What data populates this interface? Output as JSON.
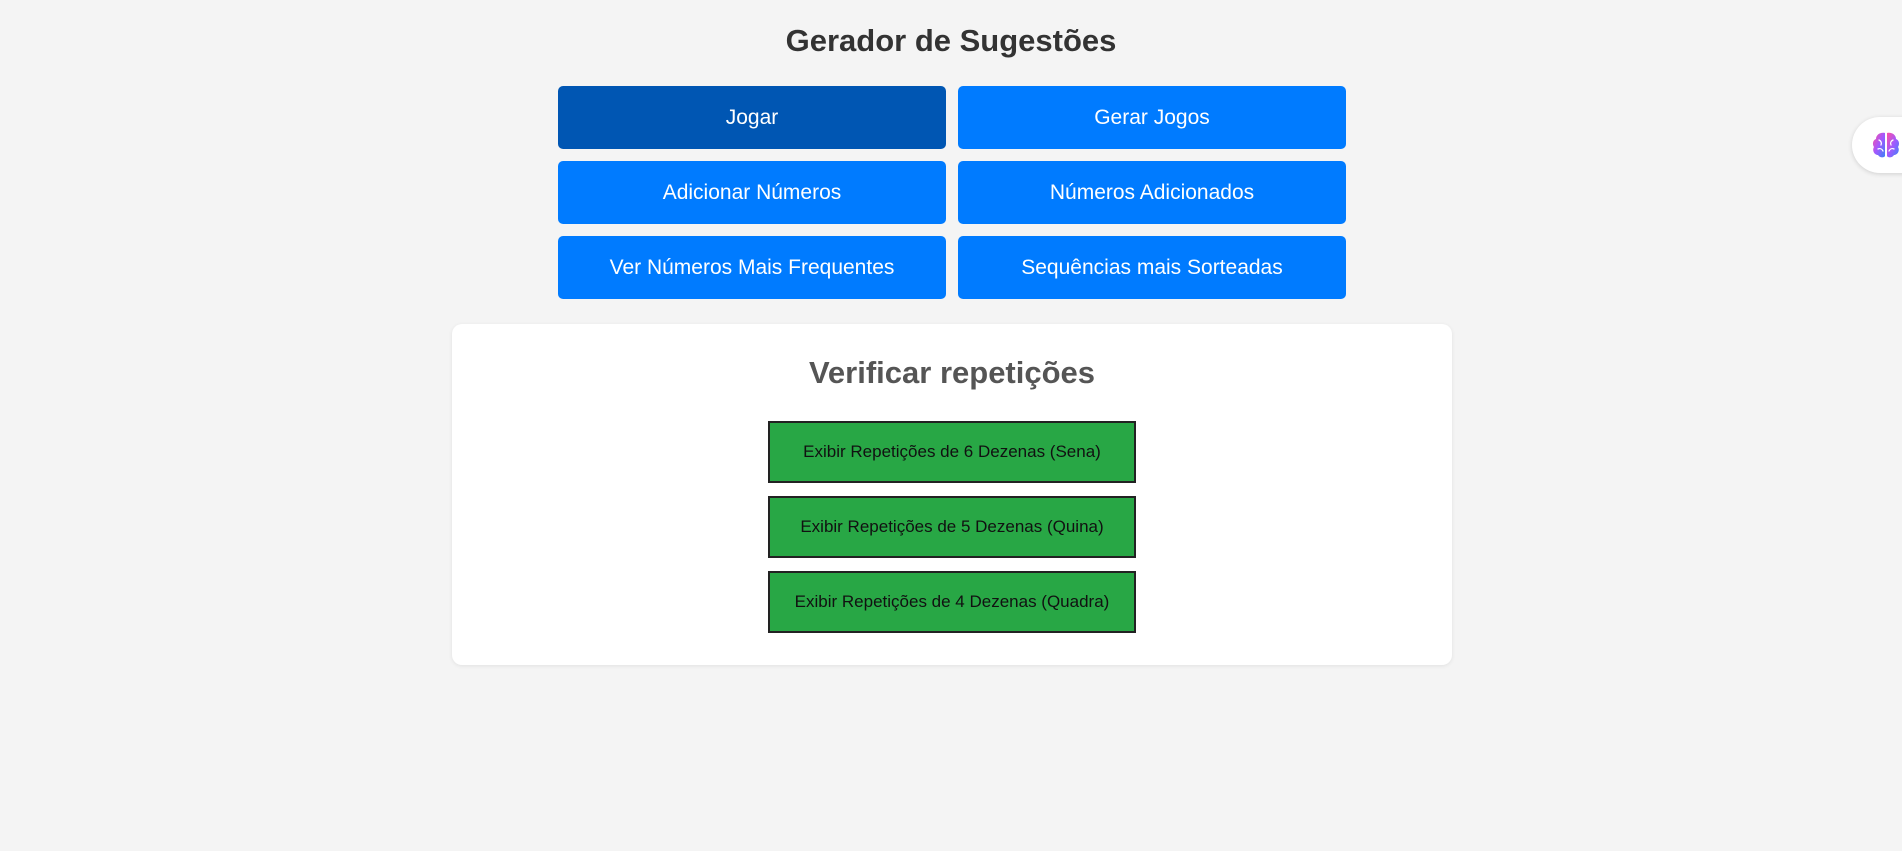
{
  "header": {
    "title": "Gerador de Sugestões"
  },
  "nav": {
    "buttons": [
      {
        "label": "Jogar",
        "active": true
      },
      {
        "label": "Gerar Jogos",
        "active": false
      },
      {
        "label": "Adicionar Números",
        "active": false
      },
      {
        "label": "Números Adicionados",
        "active": false
      },
      {
        "label": "Ver Números Mais Frequentes",
        "active": false
      },
      {
        "label": "Sequências mais Sorteadas",
        "active": false
      }
    ]
  },
  "repeticoes": {
    "title": "Verificar repetições",
    "buttons": [
      {
        "label": "Exibir Repetições de 6 Dezenas (Sena)"
      },
      {
        "label": "Exibir Repetições de 5 Dezenas (Quina)"
      },
      {
        "label": "Exibir Repetições de 4 Dezenas (Quadra)"
      }
    ]
  },
  "extension": {
    "icon": "brain-icon"
  },
  "colors": {
    "background": "#f4f4f4",
    "primary": "#007bff",
    "primary_active": "#0056b3",
    "success": "#28a745",
    "card": "#ffffff"
  }
}
